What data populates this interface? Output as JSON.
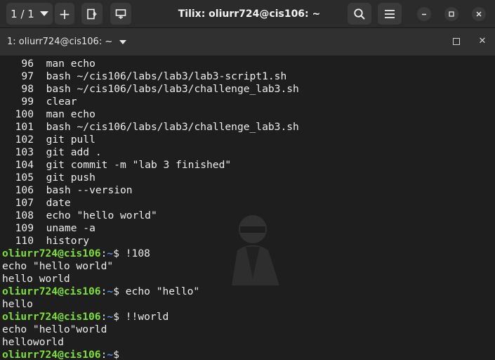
{
  "titlebar": {
    "session_label": "1 / 1",
    "window_title": "Tilix: oliurr724@cis106: ~"
  },
  "tab": {
    "label": "1: oliurr724@cis106: ~"
  },
  "history": [
    {
      "num": "96",
      "cmd": "man echo"
    },
    {
      "num": "97",
      "cmd": "bash ~/cis106/labs/lab3/lab3-script1.sh"
    },
    {
      "num": "98",
      "cmd": "bash ~/cis106/labs/lab3/challenge_lab3.sh"
    },
    {
      "num": "99",
      "cmd": "clear"
    },
    {
      "num": "100",
      "cmd": "man echo"
    },
    {
      "num": "101",
      "cmd": "bash ~/cis106/labs/lab3/challenge_lab3.sh"
    },
    {
      "num": "102",
      "cmd": "git pull"
    },
    {
      "num": "103",
      "cmd": "git add ."
    },
    {
      "num": "104",
      "cmd": "git commit -m \"lab 3 finished\""
    },
    {
      "num": "105",
      "cmd": "git push"
    },
    {
      "num": "106",
      "cmd": "bash --version"
    },
    {
      "num": "107",
      "cmd": "date"
    },
    {
      "num": "108",
      "cmd": "echo \"hello world\""
    },
    {
      "num": "109",
      "cmd": "uname -a"
    },
    {
      "num": "110",
      "cmd": "history"
    }
  ],
  "prompt": {
    "user_host": "oliurr724@cis106",
    "colon": ":",
    "path": "~",
    "symbol": "$ "
  },
  "sessions": [
    {
      "command": "!108",
      "output": [
        "echo \"hello world\"",
        "hello world"
      ]
    },
    {
      "command": "echo \"hello\"",
      "output": [
        "hello"
      ]
    },
    {
      "command": "!!world",
      "output": [
        "echo \"hello\"world",
        "helloworld"
      ]
    }
  ],
  "colors": {
    "prompt_user": "#7ee033",
    "prompt_path": "#4d8ee8",
    "text": "#ededed",
    "background": "#1e1e1e"
  }
}
